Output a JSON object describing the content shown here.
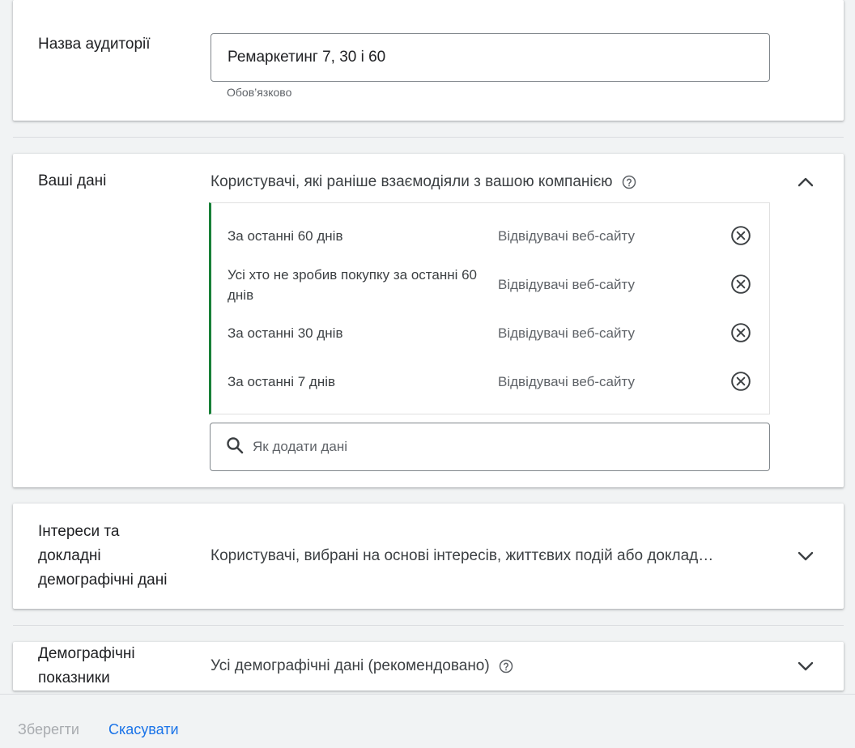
{
  "audience_name": {
    "label": "Назва аудиторії",
    "value": "Ремаркетинг 7, 30 і 60",
    "helper": "Обов’язково"
  },
  "your_data": {
    "label": "Ваші дані",
    "summary": "Користувачі, які раніше взаємодіяли з вашою компанією",
    "help_icon": "help-circle-icon",
    "chevron_icon": "chevron-up-icon",
    "segments": [
      {
        "name": "За останні 60 днів",
        "type": "Відвідувачі веб-сайту",
        "remove_icon": "cancel-circle-icon"
      },
      {
        "name": "Усі хто не зробив покупку за останні 60 днів",
        "type": "Відвідувачі веб-сайту",
        "remove_icon": "cancel-circle-icon"
      },
      {
        "name": "За останні 30 днів",
        "type": "Відвідувачі веб-сайту",
        "remove_icon": "cancel-circle-icon"
      },
      {
        "name": "За останні 7 днів",
        "type": "Відвідувачі веб-сайту",
        "remove_icon": "cancel-circle-icon"
      }
    ],
    "search_placeholder": "Як додати дані",
    "search_icon": "search-icon",
    "accent_color": "#188038"
  },
  "interests": {
    "label_lines": [
      "Інтереси та",
      "докладні",
      "демографічні дані"
    ],
    "summary": "Користувачі, вибрані на основі інтересів, життєвих подій або доклад…",
    "chevron_icon": "chevron-down-icon"
  },
  "demographics": {
    "label_lines": [
      "Демографічні",
      "показники"
    ],
    "summary": "Усі демографічні дані (рекомендовано)",
    "help_icon": "help-circle-icon",
    "chevron_icon": "chevron-down-icon"
  },
  "footer": {
    "save_label": "Зберегти",
    "cancel_label": "Скасувати",
    "link_color": "#1a73e8"
  }
}
